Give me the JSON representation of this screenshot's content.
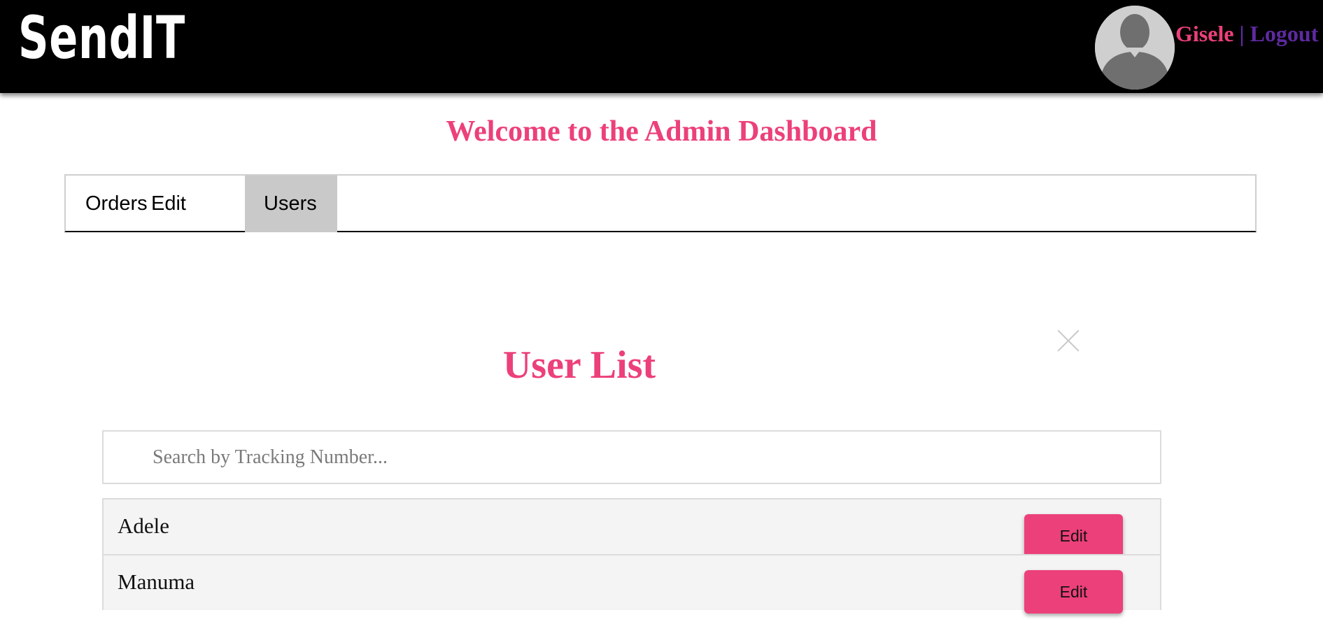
{
  "header": {
    "logo": "SendIT",
    "user_name": "Gisele",
    "separator": "|",
    "logout": "Logout"
  },
  "page_title": "Welcome to the Admin Dashboard",
  "tabs": [
    {
      "label": "Orders",
      "active": false
    },
    {
      "label": "Edit",
      "active": false
    },
    {
      "label": "Users",
      "active": true
    }
  ],
  "modal": {
    "title": "User List",
    "search_placeholder": "Search by Tracking Number...",
    "users": [
      {
        "name": "Adele",
        "edit_label": "Edit"
      },
      {
        "name": "Manuma",
        "edit_label": "Edit"
      }
    ]
  },
  "colors": {
    "accent": "#ec407a",
    "logout": "#5e2aa0",
    "header_bg": "#000000",
    "active_tab": "#c9c9c9"
  }
}
